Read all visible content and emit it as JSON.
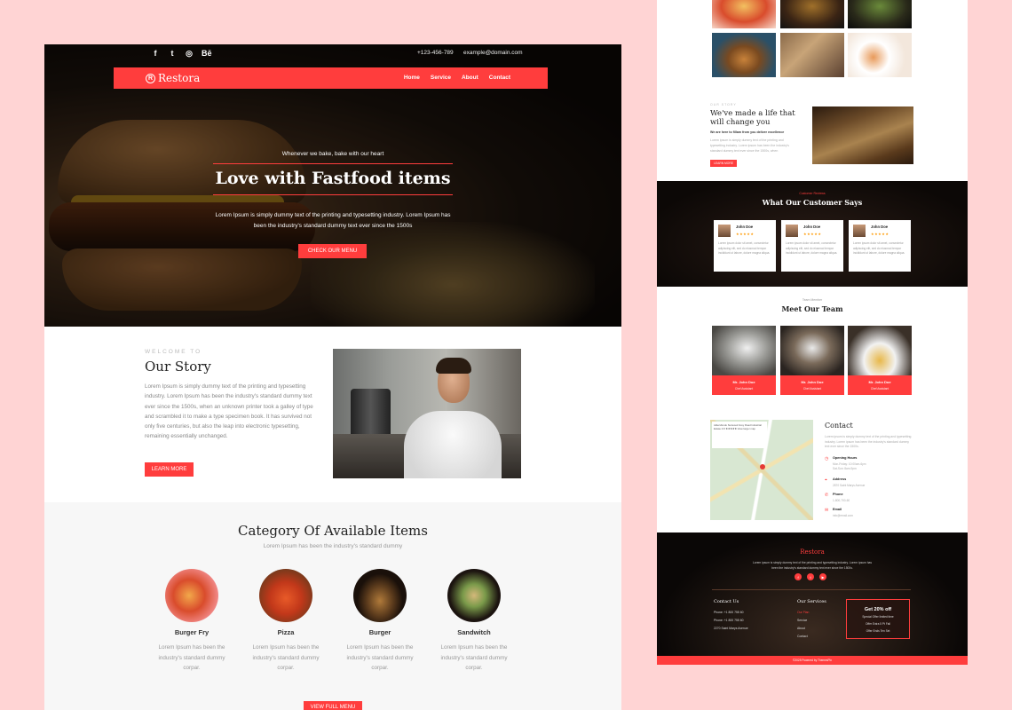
{
  "left": {
    "topbar": {
      "social": [
        "f",
        "t",
        "◎",
        "Bē"
      ],
      "phone": "+123-456-789",
      "email": "example@domain.com"
    },
    "nav": {
      "logo": "Restora",
      "logo_mark": "R",
      "menu": [
        "Home",
        "Service",
        "About",
        "Contact"
      ]
    },
    "hero": {
      "tagline": "Whenever we bake, bake with our heart",
      "title": "Love with Fastfood items",
      "text": "Lorem Ipsum is simply dummy text of the printing and typesetting industry. Lorem Ipsum has been the industry's standard dummy text ever since the 1500s",
      "button": "CHECK OUR MENU"
    },
    "story": {
      "kicker": "WELCOME TO",
      "title": "Our Story",
      "text": "Lorem Ipsum is simply dummy text of the printing and typesetting industry. Lorem Ipsum has been the industry's standard dummy text ever since the 1500s, when an unknown printer took a galley of type and scrambled it to make a type specimen book. It has survived not only five centuries, but also the leap into electronic typesetting, remaining essentially unchanged.",
      "button": "LEARN MORE"
    },
    "categories": {
      "title": "Category Of Available Items",
      "subtitle": "Lorem Ipsum has been the industry's standard dummy",
      "items": [
        {
          "name": "Burger Fry",
          "desc": "Lorem Ipsum has been the industry's standard dummy corpar."
        },
        {
          "name": "Pizza",
          "desc": "Lorem Ipsum has been the industry's standard dummy corpar."
        },
        {
          "name": "Burger",
          "desc": "Lorem Ipsum has been the industry's standard dummy corpar."
        },
        {
          "name": "Sandwitch",
          "desc": "Lorem Ipsum has been the industry's standard dummy corpar."
        }
      ],
      "button": "VIEW FULL MENU"
    }
  },
  "right": {
    "life": {
      "kicker": "OUR STORY",
      "title": "We've made a life that will change you",
      "subtitle": "We are here to fillam from you deliver excellence",
      "text": "Lorem ipsum is simply dummy text of the printing and typesetting industry. Lorem ipsum has been the industry's standard dummy text ever since the 1500s, when",
      "button": "LEARN MORE"
    },
    "testimonials": {
      "kicker": "Customer Reviews",
      "title": "What Our Customer Says",
      "cards": [
        {
          "name": "John Doe",
          "stars": "★★★★★",
          "text": "Lorem ipsum dolor sit amet, consectetur adipiscing elit, sed do eiusmod tempor incididunt ut labore, dolore magna aliqua."
        },
        {
          "name": "John Doe",
          "stars": "★★★★★",
          "text": "Lorem ipsum dolor sit amet, consectetur adipiscing elit, sed do eiusmod tempor incididunt ut labore, dolore magna aliqua."
        },
        {
          "name": "John Doe",
          "stars": "★★★★★",
          "text": "Lorem ipsum dolor sit amet, consectetur adipiscing elit, sed do eiusmod tempor incididunt ut labore, dolore magna aliqua."
        }
      ]
    },
    "team": {
      "kicker": "Team Member",
      "title": "Meet Our Team",
      "members": [
        {
          "name": "Mr. John Doe",
          "role": "Chef Assistant"
        },
        {
          "name": "Mr. John Doe",
          "role": "Chef Assistant"
        },
        {
          "name": "Mr. John Doe",
          "role": "Chef Assistant"
        }
      ]
    },
    "contact": {
      "title": "Contact",
      "text": "Lorem ipsum is simply dummy text of the printing and typesetting industry. Lorem ipsum has been the industry's standard dummy text ever since the 1500s.",
      "map_box": "Aldersbrook Sunwood Grey Road Industrial Estate 4.8 ★★★★★ View larger map",
      "items": [
        {
          "icon": "◷",
          "title": "Opening Hours",
          "value": "Mon-Friday: 10:00am-6pm\nSat-Sun: 8am-9pm"
        },
        {
          "icon": "⌖",
          "title": "Address",
          "value": "2870 Saint Marys Avenue"
        },
        {
          "icon": "✆",
          "title": "Phone",
          "value": "1-800-700-60"
        },
        {
          "icon": "✉",
          "title": "Email",
          "value": "info@email.com"
        }
      ]
    },
    "footer": {
      "logo": "Restora",
      "text": "Lorem ipsum is simply dummy text of the printing and typesetting industry. Lorem ipsum has been the industry's standard dummy text ever since the 1500s.",
      "social": [
        "f",
        "t",
        "▶"
      ],
      "contact_title": "Contact Us",
      "contact_items": [
        "Phone: +1 800 755 60",
        "Phone: +1 800 755 60",
        "2270 Saint Marys Avenue"
      ],
      "services_title": "Our Services",
      "services": [
        "Our Plan",
        "Service",
        "About",
        "Contact"
      ],
      "offer_title": "Get 20% off",
      "offer_lines": [
        "Special Offer limited time",
        "Offer Extra 5 Pt Fall",
        "Offer Ends Ten Set"
      ],
      "copyright": "©2025 Powered by ThemesPix"
    }
  }
}
